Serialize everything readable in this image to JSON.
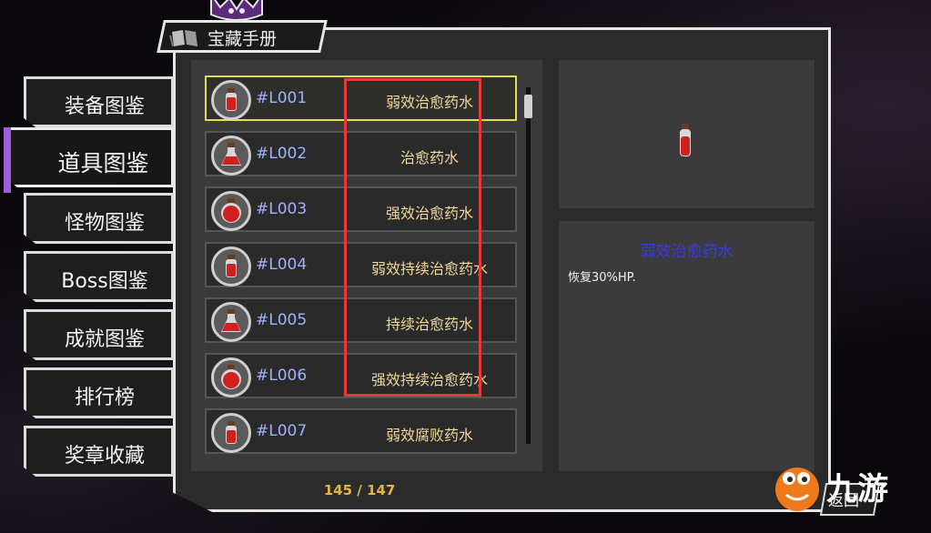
{
  "header": {
    "title": "宝藏手册",
    "icon": "book-icon"
  },
  "sidebar": {
    "items": [
      {
        "label": "装备图鉴",
        "active": false
      },
      {
        "label": "道具图鉴",
        "active": true
      },
      {
        "label": "怪物图鉴",
        "active": false
      },
      {
        "label": "Boss图鉴",
        "active": false
      },
      {
        "label": "成就图鉴",
        "active": false
      },
      {
        "label": "排行榜",
        "active": false
      },
      {
        "label": "奖章收藏",
        "active": false
      }
    ],
    "accent_color": "#9b5fd6"
  },
  "item_list": {
    "items": [
      {
        "code": "#L001",
        "name": "弱效治愈药水",
        "icon": "small-potion-icon",
        "selected": true
      },
      {
        "code": "#L002",
        "name": "治愈药水",
        "icon": "flask-potion-icon",
        "selected": false
      },
      {
        "code": "#L003",
        "name": "强效治愈药水",
        "icon": "round-potion-icon",
        "selected": false
      },
      {
        "code": "#L004",
        "name": "弱效持续治愈药水",
        "icon": "small-potion-icon",
        "selected": false
      },
      {
        "code": "#L005",
        "name": "持续治愈药水",
        "icon": "flask-potion-icon",
        "selected": false
      },
      {
        "code": "#L006",
        "name": "强效持续治愈药水",
        "icon": "round-potion-icon",
        "selected": false
      },
      {
        "code": "#L007",
        "name": "弱效腐败药水",
        "icon": "small-potion-icon",
        "selected": false
      }
    ],
    "page_counter": "145 / 147",
    "highlight_color": "#e53a3a",
    "selected_border_color": "#e8dc4c"
  },
  "detail": {
    "title": "弱效治愈药水",
    "description": "恢复30%HP.",
    "preview_icon": "small-potion-icon"
  },
  "footer": {
    "return_label": "返回",
    "watermark": "九游"
  }
}
